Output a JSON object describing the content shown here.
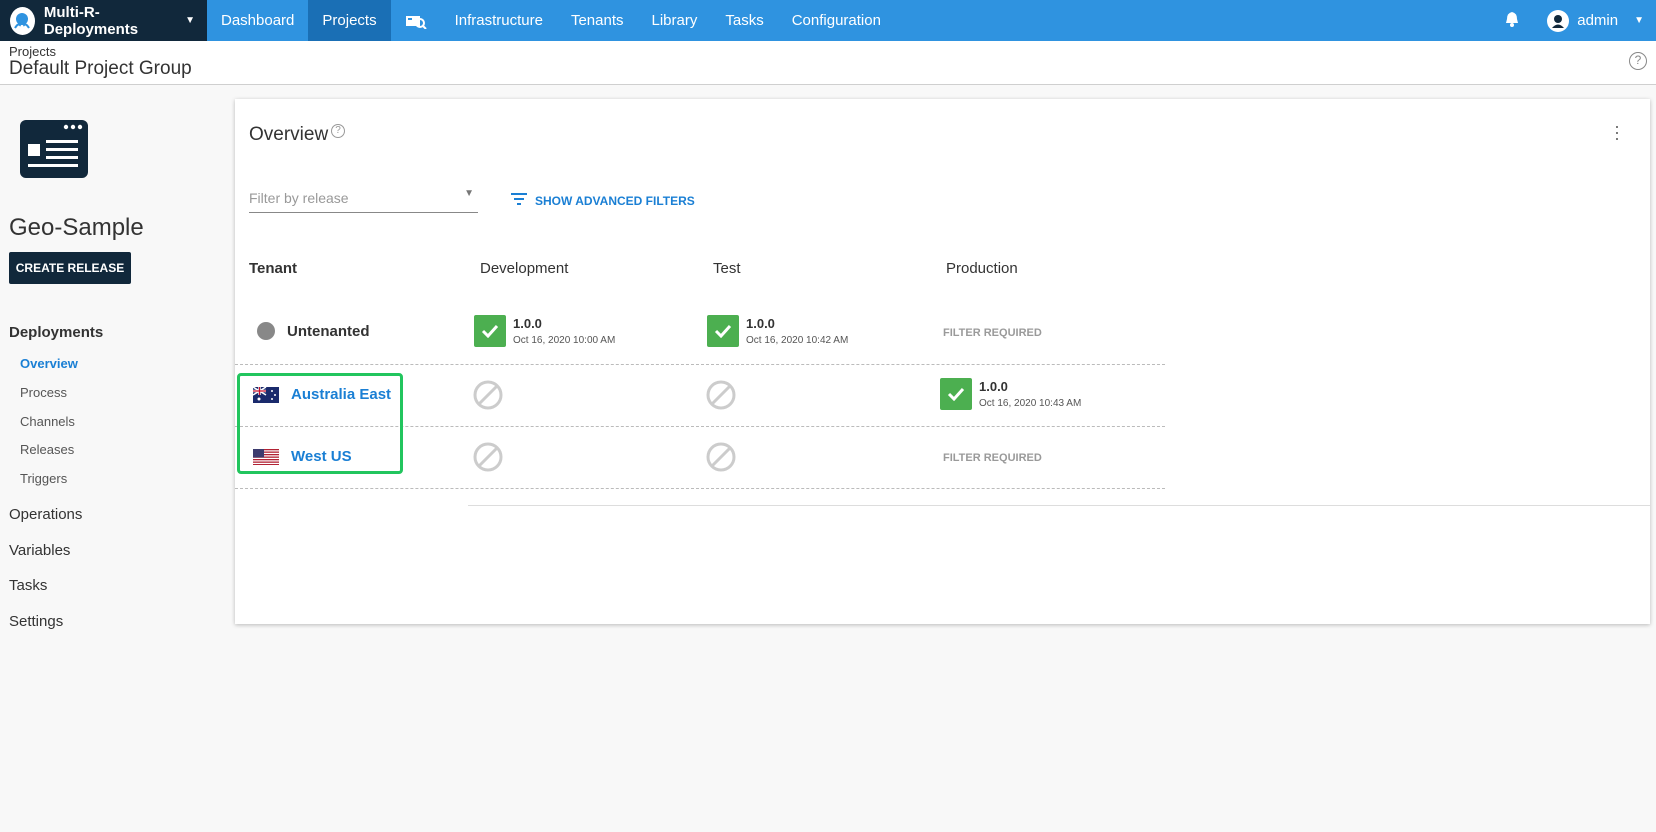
{
  "topnav": {
    "space_name": "Multi-R-Deployments",
    "items": [
      {
        "label": "Dashboard",
        "active": false
      },
      {
        "label": "Projects",
        "active": true
      },
      {
        "label": "Infrastructure",
        "active": false
      },
      {
        "label": "Tenants",
        "active": false
      },
      {
        "label": "Library",
        "active": false
      },
      {
        "label": "Tasks",
        "active": false
      },
      {
        "label": "Configuration",
        "active": false
      }
    ],
    "user": "admin"
  },
  "header": {
    "breadcrumb": "Projects",
    "title": "Default Project Group"
  },
  "sidebar": {
    "project_name": "Geo-Sample",
    "create_release": "CREATE RELEASE",
    "deployments": "Deployments",
    "sub": [
      "Overview",
      "Process",
      "Channels",
      "Releases",
      "Triggers"
    ],
    "sections": [
      "Operations",
      "Variables",
      "Tasks",
      "Settings"
    ]
  },
  "overview": {
    "title": "Overview",
    "filter_placeholder": "Filter by release",
    "advanced_filters": "SHOW ADVANCED FILTERS",
    "columns": [
      "Tenant",
      "Development",
      "Test",
      "Production"
    ],
    "rows": [
      {
        "tenant": "Untenanted",
        "development": {
          "version": "1.0.0",
          "date": "Oct 16, 2020 10:00 AM"
        },
        "test": {
          "version": "1.0.0",
          "date": "Oct 16, 2020 10:42 AM"
        },
        "production": "FILTER REQUIRED"
      },
      {
        "tenant": "Australia East",
        "production": {
          "version": "1.0.0",
          "date": "Oct 16, 2020 10:43 AM"
        }
      },
      {
        "tenant": "West US",
        "production": "FILTER REQUIRED"
      }
    ]
  },
  "colors": {
    "nav": "#2f93e0",
    "dark": "#11283b",
    "success": "#4caf50",
    "link": "#1a7fd4",
    "highlight": "#22c55e"
  }
}
